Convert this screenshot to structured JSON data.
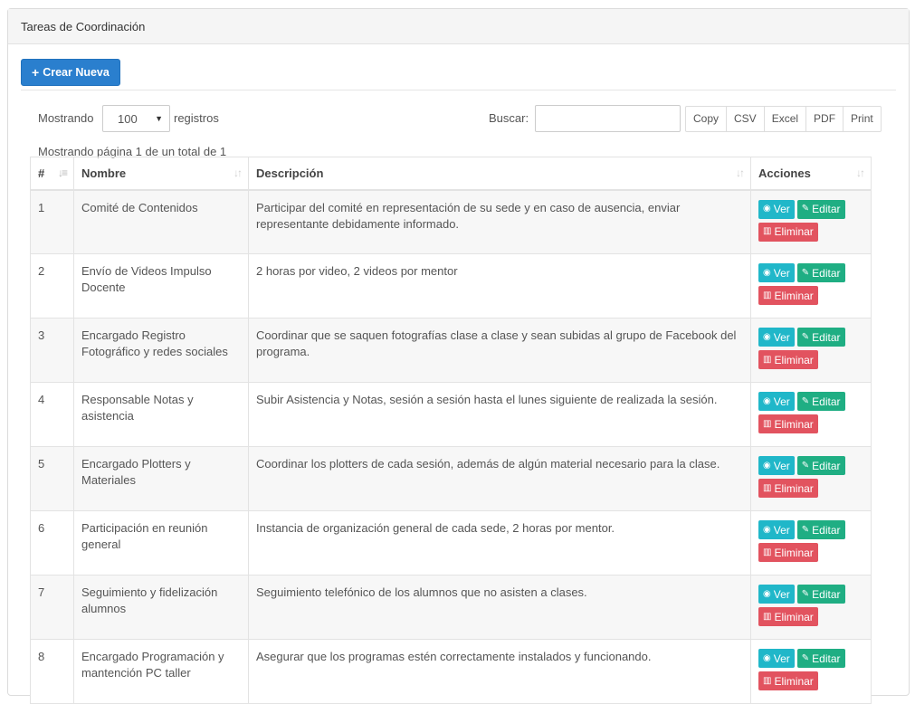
{
  "panel": {
    "title": "Tareas de Coordinación"
  },
  "toolbar": {
    "create_label": "Crear Nueva",
    "create_icon": "plus-icon"
  },
  "controls": {
    "length_prefix": "Mostrando",
    "length_value": "100",
    "length_suffix": "registros",
    "search_label": "Buscar:",
    "search_value": "",
    "exports": [
      "Copy",
      "CSV",
      "Excel",
      "PDF",
      "Print"
    ]
  },
  "info": "Mostrando página 1 de un total de 1",
  "table": {
    "columns": [
      "#",
      "Nombre",
      "Descripción",
      "Acciones"
    ],
    "action_labels": {
      "view": "Ver",
      "edit": "Editar",
      "delete": "Eliminar"
    },
    "rows": [
      {
        "id": "1",
        "name": "Comité de Contenidos",
        "desc": "Participar del comité en representación de su sede y en caso de ausencia, enviar representante debidamente informado."
      },
      {
        "id": "2",
        "name": "Envío de Videos Impulso Docente",
        "desc": "2 horas por video, 2 videos por mentor"
      },
      {
        "id": "3",
        "name": "Encargado Registro Fotográfico y redes sociales",
        "desc": "Coordinar que se saquen fotografías clase a clase y sean subidas al grupo de Facebook del programa."
      },
      {
        "id": "4",
        "name": "Responsable Notas y asistencia",
        "desc": "Subir Asistencia y Notas, sesión a sesión hasta el lunes siguiente de realizada la sesión."
      },
      {
        "id": "5",
        "name": "Encargado Plotters y Materiales",
        "desc": "Coordinar los plotters de cada sesión, además de algún material necesario para la clase."
      },
      {
        "id": "6",
        "name": "Participación en reunión general",
        "desc": "Instancia de organización general de cada sede, 2 horas por mentor."
      },
      {
        "id": "7",
        "name": "Seguimiento y fidelización alumnos",
        "desc": "Seguimiento telefónico de los alumnos que no asisten a clases."
      },
      {
        "id": "8",
        "name": "Encargado Programación y mantención PC taller",
        "desc": "Asegurar que los programas estén correctamente instalados y funcionando."
      }
    ]
  },
  "colors": {
    "primary": "#2a7fce",
    "info": "#20b7c9",
    "success": "#1fae83",
    "danger": "#e2535f"
  }
}
